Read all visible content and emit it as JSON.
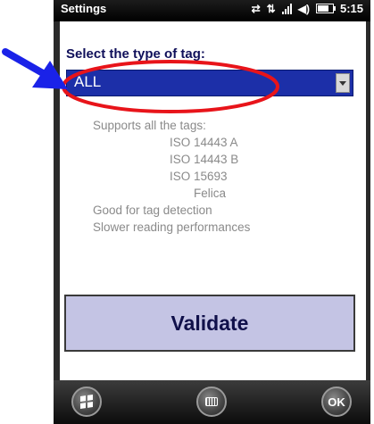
{
  "status_bar": {
    "title": "Settings",
    "time": "5:15",
    "icons": [
      "connection-icon",
      "sync-icon",
      "signal-icon",
      "volume-icon",
      "battery-icon"
    ]
  },
  "main": {
    "select_label": "Select the type of tag:",
    "dropdown": {
      "selected": "ALL"
    },
    "description": [
      "Supports all the tags:",
      "ISO 14443 A",
      "ISO 14443 B",
      "ISO 15693",
      "Felica",
      "Good for tag detection",
      "Slower reading performances"
    ],
    "validate_label": "Validate"
  },
  "bottom_bar": {
    "buttons": [
      "start-icon",
      "keyboard-icon",
      "OK"
    ]
  },
  "colors": {
    "dropdown_bg": "#1c2fa8",
    "validate_bg": "#c4c4e4",
    "annotation_red": "#e8141a",
    "annotation_blue": "#1a22e8"
  }
}
